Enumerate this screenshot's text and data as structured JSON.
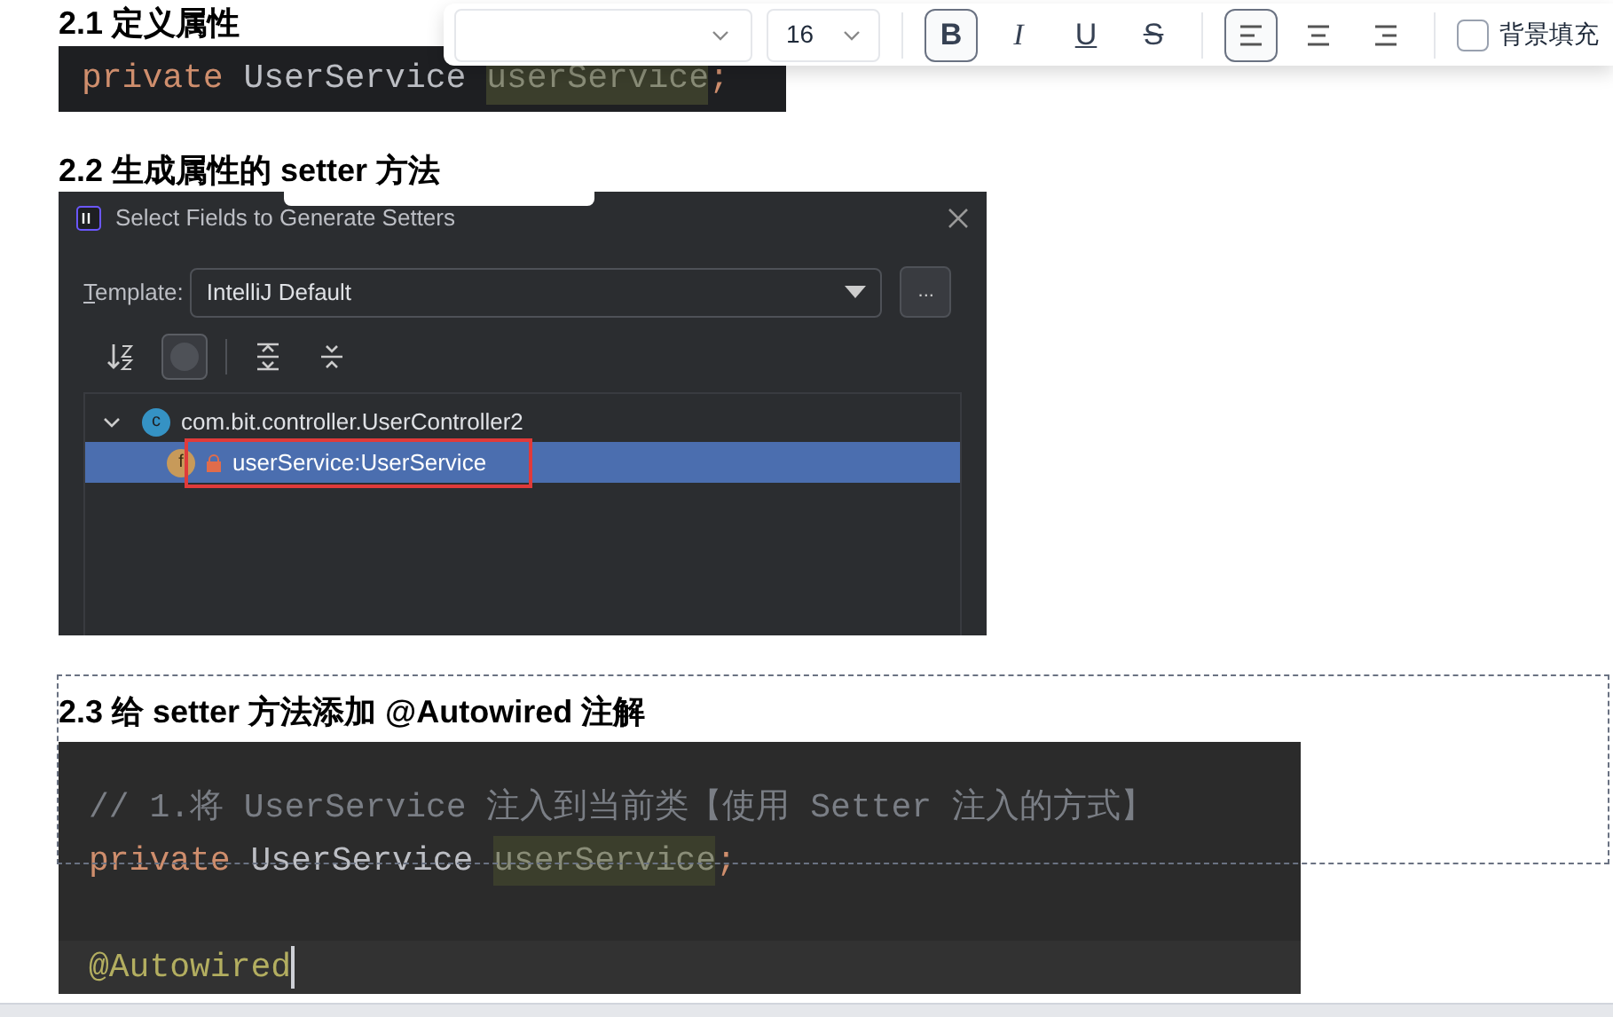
{
  "toolbar": {
    "font_size": {
      "value": "16"
    },
    "format_buttons": [
      {
        "kind": "bold",
        "label": "B",
        "selected": true
      },
      {
        "kind": "italic",
        "label": "I",
        "selected": false
      },
      {
        "kind": "underline",
        "label": "U",
        "selected": false
      },
      {
        "kind": "strike",
        "label": "S",
        "selected": false
      }
    ],
    "align_buttons": [
      {
        "kind": "left",
        "selected": true
      },
      {
        "kind": "center",
        "selected": false
      },
      {
        "kind": "right",
        "selected": false
      }
    ],
    "background_fill": {
      "label": "背景填充",
      "checked": false
    }
  },
  "sections": [
    {
      "heading": "2.1 定义属性",
      "code": {
        "lines": [
          {
            "kind": "code",
            "tokens": [
              {
                "kind": "keyword",
                "text": "private"
              },
              {
                "kind": "plain",
                "text": " UserService "
              },
              {
                "kind": "field",
                "text": "userService"
              },
              {
                "kind": "keyword",
                "text": ";"
              }
            ]
          }
        ]
      }
    },
    {
      "heading": "2.2 生成属性的 setter 方法",
      "dialog": {
        "title": "Select Fields to Generate Setters",
        "template_label": "Template:",
        "template_value": "IntelliJ Default",
        "more_button": "...",
        "tools": [
          {
            "kind": "sort",
            "selected": false
          },
          {
            "kind": "toggle",
            "selected": true
          },
          {
            "kind": "expand",
            "selected": false
          },
          {
            "kind": "collapse",
            "selected": false
          }
        ],
        "tree": [
          {
            "icon": "c",
            "label": "com.bit.controller.UserController2",
            "expanded": true,
            "selected": false,
            "children": [
              {
                "icon": "f",
                "label": "userService:UserService",
                "locked": true,
                "selected": true,
                "highlighted": true
              }
            ]
          }
        ]
      }
    },
    {
      "heading": "2.3 给 setter 方法添加 @Autowired 注解",
      "code": {
        "lines": [
          {
            "kind": "code",
            "tokens": [
              {
                "kind": "comment",
                "text": "// 1.将 UserService 注入到当前类【使用 Setter 注入的方式】"
              }
            ]
          },
          {
            "kind": "code",
            "tokens": [
              {
                "kind": "keyword",
                "text": "private"
              },
              {
                "kind": "plain",
                "text": " UserService "
              },
              {
                "kind": "field",
                "text": "userService"
              },
              {
                "kind": "keyword",
                "text": ";"
              }
            ]
          },
          {
            "kind": "blank"
          },
          {
            "kind": "code",
            "caret": true,
            "tokens": [
              {
                "kind": "annotation",
                "text": "@Autowired"
              }
            ]
          }
        ]
      }
    }
  ]
}
